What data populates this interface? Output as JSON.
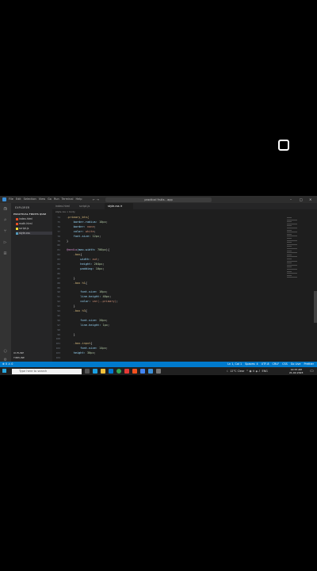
{
  "window": {
    "title": "practical fruits - app",
    "menu": [
      "File",
      "Edit",
      "Selection",
      "View",
      "Go",
      "Run",
      "Terminal",
      "Help"
    ]
  },
  "sidebar": {
    "title": "EXPLORER",
    "folder": "PRACTICAL FRUITS QUIZ",
    "files": [
      "index.html",
      "math.html",
      "script.js",
      "style.css"
    ],
    "outline": "OUTLINE",
    "timeline": "TIMELINE"
  },
  "tabs": [
    {
      "label": "index.html",
      "active": false
    },
    {
      "label": "script.js",
      "active": false
    },
    {
      "label": "style.css",
      "active": true
    }
  ],
  "breadcrumb": "style.css > body",
  "editor": {
    "lines": [
      {
        "n": "74",
        "parts": [
          [
            ".primary_btn{",
            "c-sel"
          ]
        ]
      },
      {
        "n": "75",
        "parts": [
          [
            "    border-radius: ",
            "c-prop"
          ],
          [
            "10px",
            "c-num"
          ],
          [
            ";",
            "c-punc"
          ]
        ]
      },
      {
        "n": "76",
        "parts": [
          [
            "    border: ",
            "c-prop"
          ],
          [
            "none",
            "c-val"
          ],
          [
            ";",
            "c-punc"
          ]
        ]
      },
      {
        "n": "77",
        "parts": [
          [
            "    color: ",
            "c-prop"
          ],
          [
            "white",
            "c-val"
          ],
          [
            ";",
            "c-punc"
          ]
        ]
      },
      {
        "n": "78",
        "parts": [
          [
            "    font-size: ",
            "c-prop"
          ],
          [
            "12px",
            "c-num"
          ],
          [
            ";",
            "c-punc"
          ]
        ]
      },
      {
        "n": "79",
        "parts": [
          [
            "}",
            "c-punc"
          ]
        ]
      },
      {
        "n": "80",
        "parts": []
      },
      {
        "n": "81",
        "parts": [
          [
            "@media",
            "c-key"
          ],
          [
            "(max-width: ",
            "c-prop"
          ],
          [
            "700px",
            "c-num"
          ],
          [
            "){",
            "c-punc"
          ]
        ]
      },
      {
        "n": "82",
        "parts": [
          [
            "    .box",
            "c-sel"
          ],
          [
            "{",
            "c-punc"
          ]
        ]
      },
      {
        "n": "83",
        "parts": [
          [
            "        width: ",
            "c-prop"
          ],
          [
            "aut",
            "c-val"
          ],
          [
            ";",
            "c-punc"
          ]
        ]
      },
      {
        "n": "84",
        "parts": [
          [
            "        height: ",
            "c-prop"
          ],
          [
            "264px",
            "c-num"
          ],
          [
            ";",
            "c-punc"
          ]
        ]
      },
      {
        "n": "85",
        "parts": [
          [
            "        padding: ",
            "c-prop"
          ],
          [
            "10px",
            "c-num"
          ],
          [
            ";",
            "c-punc"
          ]
        ]
      },
      {
        "n": "86",
        "parts": []
      },
      {
        "n": "87",
        "parts": [
          [
            "    }",
            "c-punc"
          ]
        ]
      },
      {
        "n": "88",
        "parts": [
          [
            "    .box h1",
            "c-sel"
          ],
          [
            "{",
            "c-punc"
          ]
        ]
      },
      {
        "n": "89",
        "parts": []
      },
      {
        "n": "90",
        "parts": [
          [
            "        font-size: ",
            "c-prop"
          ],
          [
            "16px",
            "c-num"
          ],
          [
            ";",
            "c-punc"
          ]
        ]
      },
      {
        "n": "91",
        "parts": [
          [
            "        line-height: ",
            "c-prop"
          ],
          [
            "40px",
            "c-num"
          ],
          [
            ";",
            "c-punc"
          ]
        ]
      },
      {
        "n": "92",
        "parts": [
          [
            "        color: ",
            "c-prop"
          ],
          [
            "var(--primary)",
            "c-val"
          ],
          [
            ";",
            "c-punc"
          ]
        ]
      },
      {
        "n": "93",
        "parts": [
          [
            "    }",
            "c-punc"
          ]
        ]
      },
      {
        "n": "94",
        "parts": [
          [
            "    .box h3",
            "c-sel"
          ],
          [
            "{",
            "c-punc"
          ]
        ]
      },
      {
        "n": "95",
        "parts": []
      },
      {
        "n": "96",
        "parts": [
          [
            "        font-size: ",
            "c-prop"
          ],
          [
            "20px",
            "c-num"
          ],
          [
            ";",
            "c-punc"
          ]
        ]
      },
      {
        "n": "97",
        "parts": [
          [
            "        line-height: ",
            "c-prop"
          ],
          [
            "1px",
            "c-num"
          ],
          [
            ";",
            "c-punc"
          ]
        ]
      },
      {
        "n": "98",
        "parts": []
      },
      {
        "n": "99",
        "parts": [
          [
            "    }",
            "c-punc"
          ]
        ]
      },
      {
        "n": "100",
        "parts": []
      },
      {
        "n": "101",
        "parts": [
          [
            "    .box-input",
            "c-sel"
          ],
          [
            "{",
            "c-punc"
          ]
        ]
      },
      {
        "n": "102",
        "parts": [
          [
            "        font-size: ",
            "c-prop"
          ],
          [
            "14px",
            "c-num"
          ],
          [
            ";",
            "c-punc"
          ]
        ]
      },
      {
        "n": "103",
        "parts": [
          [
            "    height: ",
            "c-prop"
          ],
          [
            "30px",
            "c-num"
          ],
          [
            ";",
            "c-punc"
          ]
        ]
      },
      {
        "n": "104",
        "parts": []
      }
    ]
  },
  "statusbar": {
    "left": "⊗ 0 ⚠ 0",
    "right": [
      "Ln 1, Col 1",
      "Spaces: 4",
      "UTF-8",
      "CRLF",
      "CSS",
      "Go Live",
      "Prettier"
    ]
  },
  "taskbar": {
    "search_placeholder": "Type here to search",
    "weather": "12°C Clear",
    "lang": "ENG",
    "time": "12:33 AM",
    "date": "21-02-2023"
  },
  "colors": {
    "statusbar": "#007acc",
    "editor_bg": "#1e1e1e",
    "sidebar_bg": "#252526"
  }
}
